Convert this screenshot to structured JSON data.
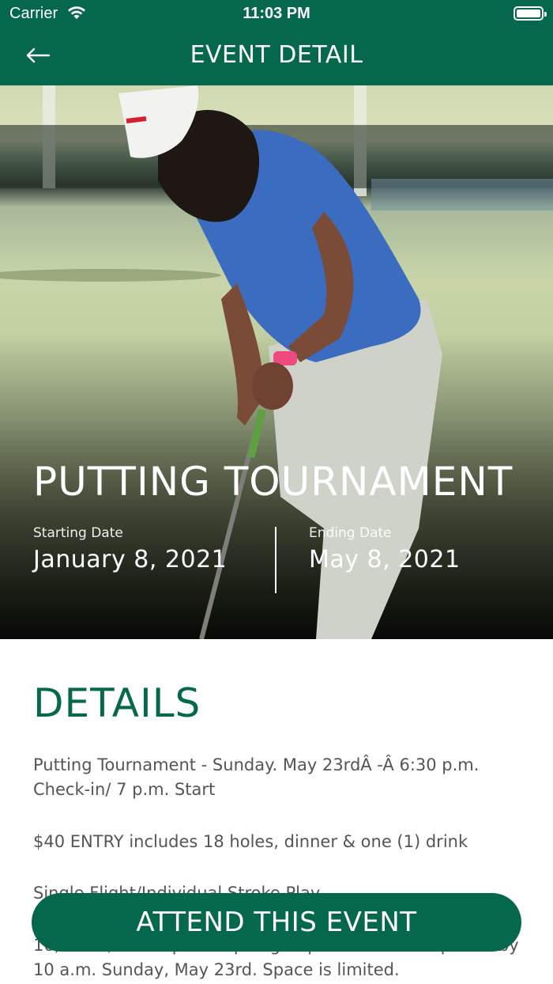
{
  "status": {
    "carrier": "Carrier",
    "time": "11:03 PM"
  },
  "header": {
    "title": "EVENT DETAIL"
  },
  "event": {
    "name": "PUTTING TOURNAMENT",
    "start_label": "Starting Date",
    "start_value": "January 8, 2021",
    "end_label": "Ending Date",
    "end_value": "May 8, 2021"
  },
  "details": {
    "heading": "DETAILS",
    "paragraphs": [
      "Putting Tournament - Sunday. May 23rdÂ  -Â  6:30 p.m. Check-in/ 7 p.m. Start",
      "$40 ENTRY includes 18 holes, dinner & one (1) drink",
      "Single Flight/Individual Stroke Play",
      "16, 2021, at the pro shop. Sign-ups must be completed by 10 a.m. Sunday, May 23rd. Space is limited."
    ]
  },
  "cta": {
    "label": "ATTEND THIS EVENT"
  },
  "colors": {
    "brand_green": "#05684c"
  }
}
